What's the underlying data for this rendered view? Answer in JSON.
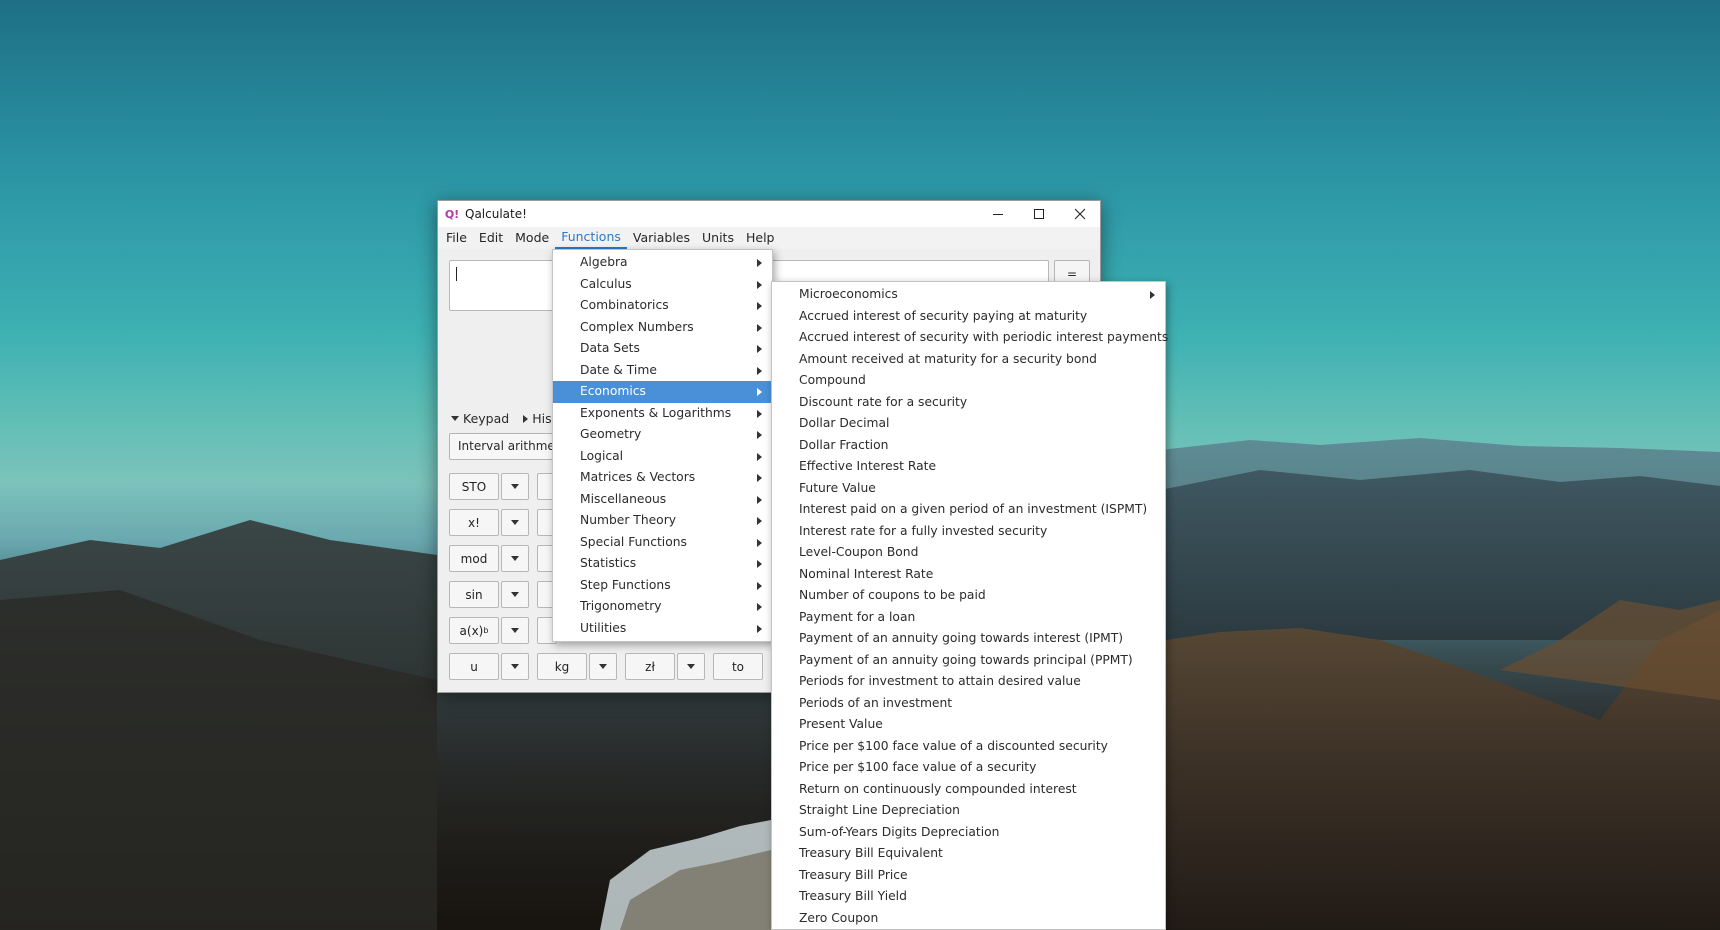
{
  "window": {
    "title": "Qalculate!",
    "icon": "qalculate-icon",
    "controls": [
      "minimize-icon",
      "maximize-icon",
      "close-icon"
    ]
  },
  "menubar": [
    "File",
    "Edit",
    "Mode",
    "Functions",
    "Variables",
    "Units",
    "Help"
  ],
  "active_menu": "Functions",
  "equals_label": "=",
  "toggles": {
    "keypad": "Keypad",
    "history": "Hist"
  },
  "mode_combo": "Interval arithmet",
  "keypad": {
    "col1": [
      "STO",
      "x!",
      "mod",
      "sin",
      "a(x)",
      "u"
    ],
    "col1_sup": "b",
    "bottom_row": [
      "kg",
      "zł",
      "to"
    ]
  },
  "functions_menu": [
    "Algebra",
    "Calculus",
    "Combinatorics",
    "Complex Numbers",
    "Data Sets",
    "Date & Time",
    "Economics",
    "Exponents & Logarithms",
    "Geometry",
    "Logical",
    "Matrices & Vectors",
    "Miscellaneous",
    "Number Theory",
    "Special Functions",
    "Statistics",
    "Step Functions",
    "Trigonometry",
    "Utilities"
  ],
  "selected_category": "Economics",
  "economics_menu": [
    "Microeconomics",
    "Accrued interest of security paying at maturity",
    "Accrued interest of security with periodic interest payments",
    "Amount received at maturity for a security bond",
    "Compound",
    "Discount rate for a security",
    "Dollar Decimal",
    "Dollar Fraction",
    "Effective Interest Rate",
    "Future Value",
    "Interest paid on a given period of an investment (ISPMT)",
    "Interest rate for a fully invested security",
    "Level-Coupon Bond",
    "Nominal Interest Rate",
    "Number of coupons to be paid",
    "Payment for a loan",
    "Payment of an annuity going towards interest (IPMT)",
    "Payment of an annuity going towards principal (PPMT)",
    "Periods for investment to attain desired value",
    "Periods of an investment",
    "Present Value",
    "Price per $100 face value of a discounted security",
    "Price per $100 face value of a security",
    "Return on continuously compounded interest",
    "Straight Line Depreciation",
    "Sum-of-Years Digits Depreciation",
    "Treasury Bill Equivalent",
    "Treasury Bill Price",
    "Treasury Bill Yield",
    "Zero Coupon"
  ]
}
